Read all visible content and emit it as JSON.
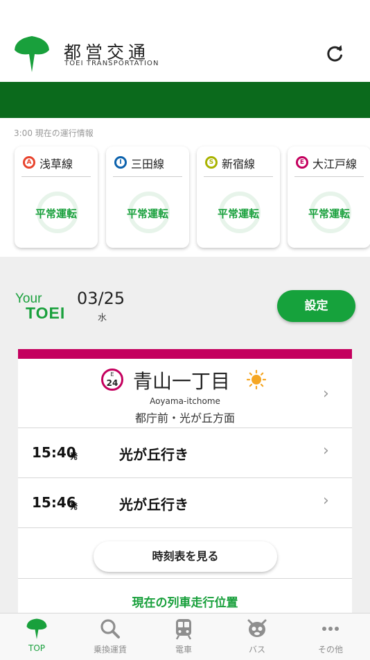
{
  "header": {
    "brand_kanji": "都営交通",
    "brand_en": "TOEI TRANSPORTATION",
    "refresh_icon": "refresh-icon"
  },
  "status": {
    "caption": "3:00 現在の運行情報",
    "lines": [
      {
        "letter": "A",
        "name": "浅草線",
        "status": "平常運転",
        "color": "#e8442e"
      },
      {
        "letter": "I",
        "name": "三田線",
        "status": "平常運転",
        "color": "#0c62ad"
      },
      {
        "letter": "S",
        "name": "新宿線",
        "status": "平常運転",
        "color": "#a9b300"
      },
      {
        "letter": "E",
        "name": "大江戸線",
        "status": "平常運転",
        "color": "#c4005e"
      }
    ]
  },
  "your_toei": {
    "your": "Your",
    "toei": "TOEI",
    "date": "03/25",
    "weekday": "水",
    "settings_label": "設定"
  },
  "station": {
    "line_letter": "E",
    "number": "24",
    "name": "青山一丁目",
    "roman": "Aoyama-itchome",
    "direction": "都庁前・光が丘方面",
    "weather_icon": "sun-icon",
    "departures": [
      {
        "time": "15:40",
        "suffix": "発",
        "destination": "光が丘行き"
      },
      {
        "time": "15:46",
        "suffix": "発",
        "destination": "光が丘行き"
      }
    ],
    "timetable_label": "時刻表を見る",
    "position_label": "現在の列車走行位置"
  },
  "tabs": [
    {
      "label": "TOP",
      "icon": "ginkgo-icon",
      "active": true
    },
    {
      "label": "乗換運賃",
      "icon": "search-icon",
      "active": false
    },
    {
      "label": "電車",
      "icon": "train-icon",
      "active": false
    },
    {
      "label": "バス",
      "icon": "bus-mascot-icon",
      "active": false
    },
    {
      "label": "その他",
      "icon": "more-icon",
      "active": false
    }
  ],
  "colors": {
    "brand_green": "#19a03c",
    "dark_green": "#0b6a1c",
    "oedo_magenta": "#c4005e"
  }
}
